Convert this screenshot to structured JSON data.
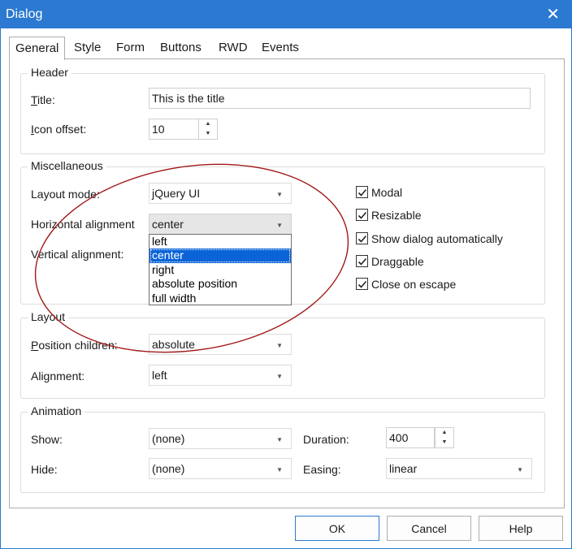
{
  "window": {
    "title": "Dialog",
    "close_glyph": "✕"
  },
  "tabs": [
    {
      "label": "General",
      "active": true
    },
    {
      "label": "Style"
    },
    {
      "label": "Form"
    },
    {
      "label": "Buttons"
    },
    {
      "label": "RWD"
    },
    {
      "label": "Events"
    }
  ],
  "header": {
    "legend": "Header",
    "title_label_mn": "T",
    "title_label_rest": "itle:",
    "title_value": "This is the title",
    "icon_offset_label_mn": "I",
    "icon_offset_label_rest": "con offset:",
    "icon_offset_value": "10"
  },
  "misc": {
    "legend": "Miscellaneous",
    "layout_mode_label": "Layout mode:",
    "layout_mode_value": "jQuery UI",
    "h_align_label": "Horizontal alignment",
    "h_align_value": "center",
    "v_align_label": "Vertical alignment:",
    "h_align_options": [
      "left",
      "center",
      "right",
      "absolute position",
      "full width"
    ],
    "selected_option_index": 1,
    "checkboxes": [
      {
        "label": "Modal",
        "checked": true
      },
      {
        "label": "Resizable",
        "checked": true
      },
      {
        "label": "Show dialog automatically",
        "checked": true
      },
      {
        "label": "Draggable",
        "checked": true
      },
      {
        "label": "Close on escape",
        "checked": true
      }
    ]
  },
  "layout": {
    "legend": "Layout",
    "position_children_label_mn": "P",
    "position_children_label_rest": "osition children:",
    "position_children_value": "absolute",
    "alignment_label": "Alignment:",
    "alignment_value": "left"
  },
  "animation": {
    "legend": "Animation",
    "show_label": "Show:",
    "show_value": "(none)",
    "hide_label": "Hide:",
    "hide_value": "(none)",
    "duration_label": "Duration:",
    "duration_value": "400",
    "easing_label": "Easing:",
    "easing_value": "linear"
  },
  "buttons": {
    "ok": "OK",
    "cancel": "Cancel",
    "help": "Help"
  },
  "colors": {
    "titlebar": "#2b79d0",
    "selection": "#0a64d8",
    "annotation": "#a01818"
  },
  "icons": {
    "close": "close-icon",
    "check": "check-icon",
    "spin_up": "spin-up-icon",
    "spin_down": "spin-down-icon",
    "dropdown": "chevron-down-icon"
  }
}
